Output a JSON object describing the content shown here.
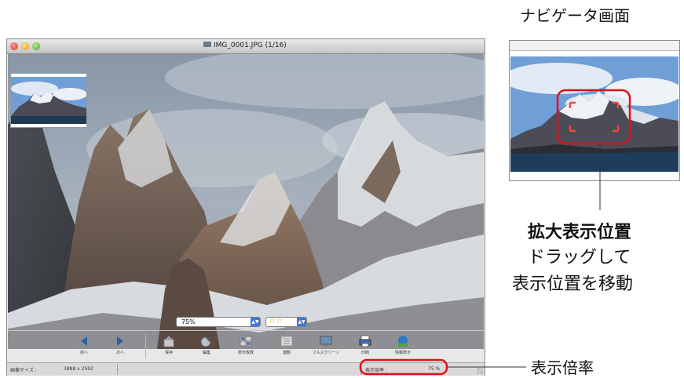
{
  "window": {
    "title": "IMG_0001.JPG (1/16)"
  },
  "controls": {
    "zoom_value": "75%",
    "rating_value": "☆☆"
  },
  "toolbar": {
    "items": [
      {
        "label": "前へ",
        "icon": "prev-arrow-icon"
      },
      {
        "label": "次へ",
        "icon": "next-arrow-icon"
      },
      {
        "label": "保存",
        "icon": "save-icon"
      },
      {
        "label": "編集",
        "icon": "edit-icon"
      },
      {
        "label": "表示枚数",
        "icon": "layout-icon"
      },
      {
        "label": "連動",
        "icon": "sync-icon"
      },
      {
        "label": "フルスクリーン",
        "icon": "fullscreen-icon"
      },
      {
        "label": "印刷",
        "icon": "print-icon"
      },
      {
        "label": "情報表示",
        "icon": "info-icon"
      }
    ]
  },
  "status": {
    "size_label": "画像サイズ :",
    "size_value": "3888 x 2592",
    "zoom_label": "表示倍率 :",
    "zoom_value": "75 %"
  },
  "annotations": {
    "navigator_title": "ナビゲータ画面",
    "zoom_position_title": "拡大表示位置",
    "drag_line1": "ドラッグして",
    "drag_line2": "表示位置を移動",
    "zoom_rate": "表示倍率"
  },
  "colors": {
    "highlight": "#e0101a",
    "button_blue": "#3d7ad6"
  }
}
